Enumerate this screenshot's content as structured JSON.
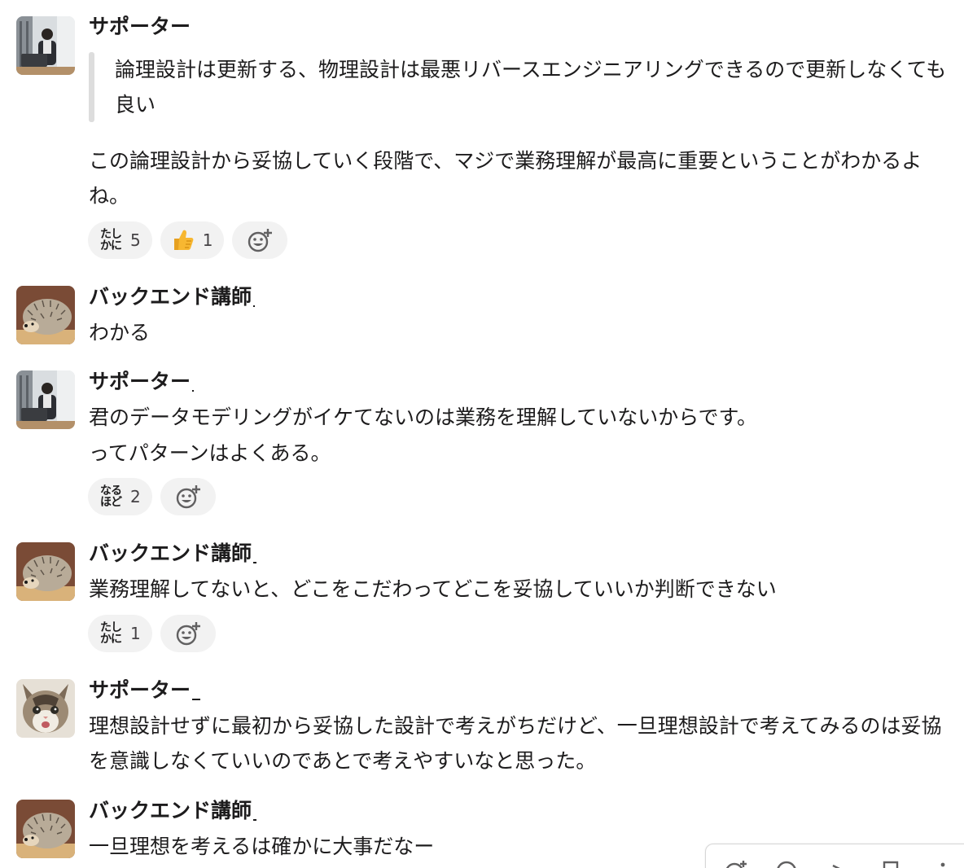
{
  "messages": [
    {
      "author": "サポーター",
      "quote": "論理設計は更新する、物理設計は最悪リバースエンジニアリングできるので更新しなくても良い",
      "body": "この論理設計から妥協していく段階で、マジで業務理解が最高に重要ということがわかるよね。",
      "reactions": [
        {
          "stamp_line1": "たし",
          "stamp_line2": "かに",
          "count": "5"
        },
        {
          "icon": "thumbs-up-icon",
          "count": "1"
        }
      ]
    },
    {
      "author": "バックエンド講師",
      "body": "わかる"
    },
    {
      "author": "サポーター",
      "body_line1": "君のデータモデリングがイケてないのは業務を理解していないからです。",
      "body_line2": "ってパターンはよくある。",
      "reactions": [
        {
          "stamp_line1": "なる",
          "stamp_line2": "ほど",
          "count": "2"
        }
      ]
    },
    {
      "author": "バックエンド講師",
      "body": "業務理解してないと、どこをこだわってどこを妥協していいか判断できない",
      "reactions": [
        {
          "stamp_line1": "たし",
          "stamp_line2": "かに",
          "count": "1"
        }
      ]
    },
    {
      "author": "サポーター",
      "body": "理想設計せずに最初から妥協した設計で考えがちだけど、一旦理想設計で考えてみるのは妥協を意識しなくていいのであとで考えやすいなと思った。"
    },
    {
      "author": "バックエンド講師",
      "body": "一旦理想を考えるは確かに大事だなー"
    }
  ],
  "colors": {
    "text": "#1d1c1d",
    "reaction_bg": "#f2f2f2",
    "quote_bar": "#dddddd",
    "thumb": "#f7b731"
  },
  "toolbar_icons": [
    "add-reaction-icon",
    "reply-icon",
    "forward-icon",
    "bookmark-icon",
    "more-icon"
  ]
}
